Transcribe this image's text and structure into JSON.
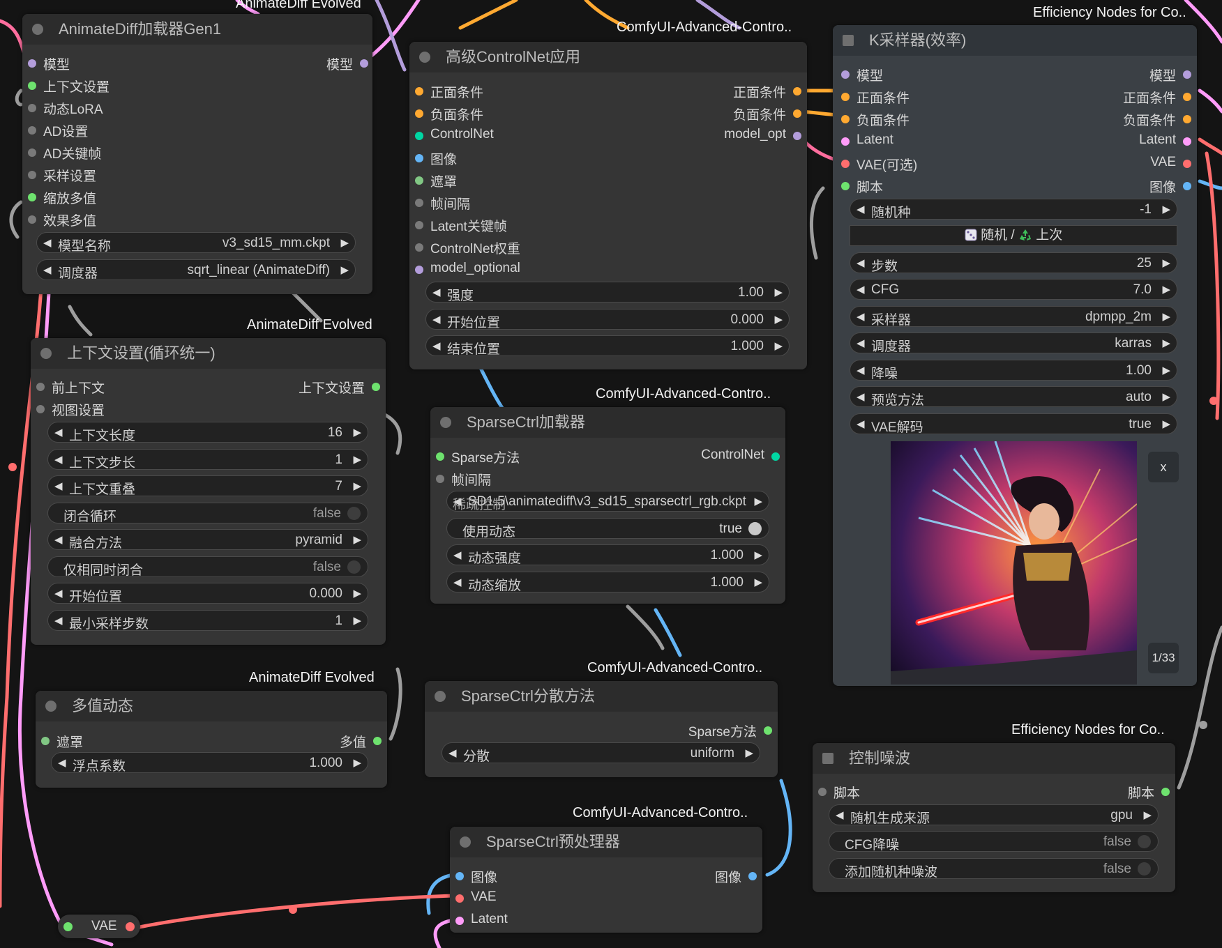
{
  "sources": {
    "animatediff_top": "AnimateDiff Evolved",
    "advanced_controlnet_top": "ComfyUI-Advanced-Contro..",
    "efficiency_top": "Efficiency Nodes for Co..",
    "animatediff_context": "AnimateDiff Evolved",
    "advanced_controlnet_sparse_loader": "ComfyUI-Advanced-Contro..",
    "animatediff_multival": "AnimateDiff Evolved",
    "advanced_controlnet_sparse_method": "ComfyUI-Advanced-Contro..",
    "efficiency_noise": "Efficiency Nodes for Co..",
    "advanced_controlnet_preprocessor": "ComfyUI-Advanced-Contro.."
  },
  "loader": {
    "title": "AnimateDiff加载器Gen1",
    "in_model": "模型",
    "out_model": "模型",
    "in_context": "上下文设置",
    "in_motion_lora": "动态LoRA",
    "in_ad_settings": "AD设置",
    "in_ad_keyframes": "AD关键帧",
    "in_sample_settings": "采样设置",
    "in_scale_multival": "缩放多值",
    "in_effect_multival": "效果多值",
    "model_name_label": "模型名称",
    "model_name_value": "v3_sd15_mm.ckpt",
    "beta_label": "调度器",
    "beta_value": "sqrt_linear (AnimateDiff)"
  },
  "context": {
    "title": "上下文设置(循环统一)",
    "in_prev_context": "前上下文",
    "in_view_opts": "视图设置",
    "out_context": "上下文设置",
    "length_label": "上下文长度",
    "length_value": "16",
    "stride_label": "上下文步长",
    "stride_value": "1",
    "overlap_label": "上下文重叠",
    "overlap_value": "7",
    "closed_loop_label": "闭合循环",
    "closed_loop_value": "false",
    "fuse_label": "融合方法",
    "fuse_value": "pyramid",
    "sync_label": "仅相同时闭合",
    "sync_value": "false",
    "start_label": "开始位置",
    "start_value": "0.000",
    "min_steps_label": "最小采样步数",
    "min_steps_value": "1"
  },
  "multival": {
    "title": "多值动态",
    "in_mask": "遮罩",
    "out_multival": "多值",
    "float_label": "浮点系数",
    "float_value": "1.000"
  },
  "advcn": {
    "title": "高级ControlNet应用",
    "in_positive": "正面条件",
    "out_positive": "正面条件",
    "in_negative": "负面条件",
    "out_negative": "负面条件",
    "in_controlnet": "ControlNet",
    "out_model_opt": "model_opt",
    "in_image": "图像",
    "in_mask": "遮罩",
    "in_timestep_kf": "帧间隔",
    "in_latent_kf": "Latent关键帧",
    "in_cn_weights": "ControlNet权重",
    "in_model_optional": "model_optional",
    "strength_label": "强度",
    "strength_value": "1.00",
    "start_label": "开始位置",
    "start_value": "0.000",
    "end_label": "结束位置",
    "end_value": "1.000"
  },
  "sparse_loader": {
    "title": "SparseCtrl加载器",
    "in_sparse_method": "Sparse方法",
    "out_controlnet": "ControlNet",
    "in_timestep": "帧间隔",
    "ckpt_overlap_a": "SD1.5\\animatediff\\v3_sd15_sparsectrl_rgb.ckpt",
    "ckpt_overlap_b": "稀疏控制",
    "use_motion_label": "使用动态",
    "use_motion_value": "true",
    "motion_strength_label": "动态强度",
    "motion_strength_value": "1.000",
    "motion_scale_label": "动态缩放",
    "motion_scale_value": "1.000"
  },
  "sparse_method": {
    "title": "SparseCtrl分散方法",
    "out_sparse_method": "Sparse方法",
    "spread_label": "分散",
    "spread_value": "uniform"
  },
  "sparse_pre": {
    "title": "SparseCtrl预处理器",
    "in_image": "图像",
    "out_image": "图像",
    "in_vae": "VAE",
    "in_latent": "Latent"
  },
  "vae_reroute": {
    "label": "VAE"
  },
  "ksampler": {
    "title": "K采样器(效率)",
    "in_model": "模型",
    "out_model": "模型",
    "in_positive": "正面条件",
    "out_positive": "正面条件",
    "in_negative": "负面条件",
    "out_negative": "负面条件",
    "in_latent": "Latent",
    "out_latent": "Latent",
    "in_vae": "VAE(可选)",
    "out_vae": "VAE",
    "in_script": "脚本",
    "out_image": "图像",
    "seed_label": "随机种",
    "seed_value": "-1",
    "seed_btn_random": "随机 /",
    "seed_btn_last": "上次",
    "steps_label": "步数",
    "steps_value": "25",
    "cfg_label": "CFG",
    "cfg_value": "7.0",
    "sampler_label": "采样器",
    "sampler_value": "dpmpp_2m",
    "scheduler_label": "调度器",
    "scheduler_value": "karras",
    "denoise_label": "降噪",
    "denoise_value": "1.00",
    "preview_label": "预览方法",
    "preview_value": "auto",
    "vae_decode_label": "VAE解码",
    "vae_decode_value": "true",
    "close_label": "x",
    "image_counter": "1/33"
  },
  "noise": {
    "title": "控制噪波",
    "in_script": "脚本",
    "out_script": "脚本",
    "rng_label": "随机生成来源",
    "rng_value": "gpu",
    "cfg_denoise_label": "CFG降噪",
    "cfg_denoise_value": "false",
    "add_seed_noise_label": "添加随机种噪波",
    "add_seed_noise_value": "false"
  },
  "icons": {
    "arrow_left": "◀",
    "arrow_right": "▶",
    "dice": "dice-icon",
    "recycle": "recycle-icon"
  },
  "colors": {
    "model": "#b39ddb",
    "conditioning": "#ffa931",
    "controlnet": "#00d6a3",
    "image": "#64b5f6",
    "mask": "#81c784",
    "latent": "#ff9cf9",
    "vae": "#ff6e6e",
    "context": "#6ee26e",
    "inactive": "#7a7a7a"
  }
}
